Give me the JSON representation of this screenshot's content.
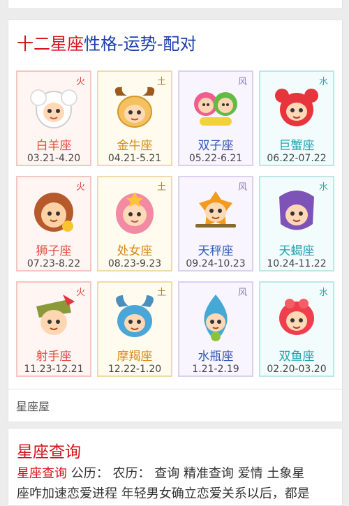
{
  "section": {
    "title_red": "十二星座",
    "title_blue": "性格-运势-配对",
    "footer_label": "星座屋"
  },
  "signs": [
    {
      "name": "白羊座",
      "dates": "03.21-4.20",
      "element": "火",
      "type": "fire",
      "icon": "aries-mascot-icon",
      "color": "#ffffff"
    },
    {
      "name": "金牛座",
      "dates": "04.21-5.21",
      "element": "土",
      "type": "earth",
      "icon": "taurus-mascot-icon",
      "color": "#e8a521"
    },
    {
      "name": "双子座",
      "dates": "05.22-6.21",
      "element": "风",
      "type": "air",
      "icon": "gemini-mascot-icon",
      "color": "#7cc84a"
    },
    {
      "name": "巨蟹座",
      "dates": "06.22-07.22",
      "element": "水",
      "type": "water",
      "icon": "cancer-mascot-icon",
      "color": "#e6353c"
    },
    {
      "name": "狮子座",
      "dates": "07.23-8.22",
      "element": "火",
      "type": "fire",
      "icon": "leo-mascot-icon",
      "color": "#b65a2b"
    },
    {
      "name": "处女座",
      "dates": "08.23-9.23",
      "element": "土",
      "type": "earth",
      "icon": "virgo-mascot-icon",
      "color": "#f28aa3"
    },
    {
      "name": "天秤座",
      "dates": "09.24-10.23",
      "element": "风",
      "type": "air",
      "icon": "libra-mascot-icon",
      "color": "#f39b1f"
    },
    {
      "name": "天蝎座",
      "dates": "10.24-11.22",
      "element": "水",
      "type": "water",
      "icon": "scorpio-mascot-icon",
      "color": "#7e53b8"
    },
    {
      "name": "射手座",
      "dates": "11.23-12.21",
      "element": "火",
      "type": "fire",
      "icon": "sagittarius-mascot-icon",
      "color": "#8a9a3a"
    },
    {
      "name": "摩羯座",
      "dates": "12.22-1.20",
      "element": "土",
      "type": "earth",
      "icon": "capricorn-mascot-icon",
      "color": "#49a6d8"
    },
    {
      "name": "水瓶座",
      "dates": "1.21-2.19",
      "element": "风",
      "type": "air",
      "icon": "aquarius-mascot-icon",
      "color": "#46a8d5"
    },
    {
      "name": "双鱼座",
      "dates": "02.20-03.20",
      "element": "水",
      "type": "water",
      "icon": "pisces-mascot-icon",
      "color": "#ef3f4e"
    }
  ],
  "query": {
    "title": "星座查询",
    "link": "星座查询",
    "gongli": "公历：",
    "nongli": "农历：",
    "search": "查询",
    "precise_search": "精准查询",
    "love": "爱情",
    "line1_tail": "土象星",
    "line2": "座咋加速恋爱进程 年轻男女确立恋爱关系以后，都是"
  }
}
